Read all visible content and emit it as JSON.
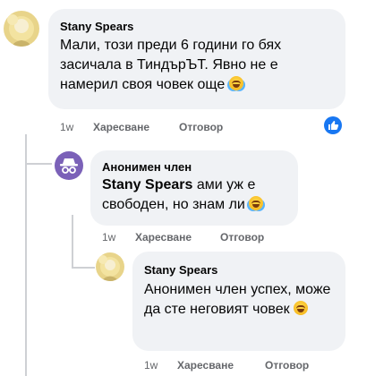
{
  "comments": [
    {
      "author": "Stany Spears",
      "text": "Мали, този преди 6 години го бях засичала в ТиндърЪТ. Явно не е намерил своя човек още",
      "emoji": "rolling-laughing-emoji",
      "time": "1w",
      "like_label": "Харесване",
      "reply_label": "Отговор",
      "reaction": "like"
    },
    {
      "author": "Анонимен член",
      "mention": "Stany Spears",
      "text": " ами уж е свободен, но знам ли",
      "emoji": "rolling-laughing-emoji",
      "time": "1w",
      "like_label": "Харесване",
      "reply_label": "Отговор"
    },
    {
      "author": "Stany Spears",
      "text": "Анонимен член успех, може да сте неговият човек",
      "emoji": "grinning-squint-emoji",
      "time": "1w",
      "like_label": "Харесване",
      "reply_label": "Отговор"
    }
  ],
  "colors": {
    "bubble": "#f0f2f5",
    "meta": "#65676b",
    "like_blue": "#1877f2",
    "anon_purple": "#7b61b8"
  }
}
